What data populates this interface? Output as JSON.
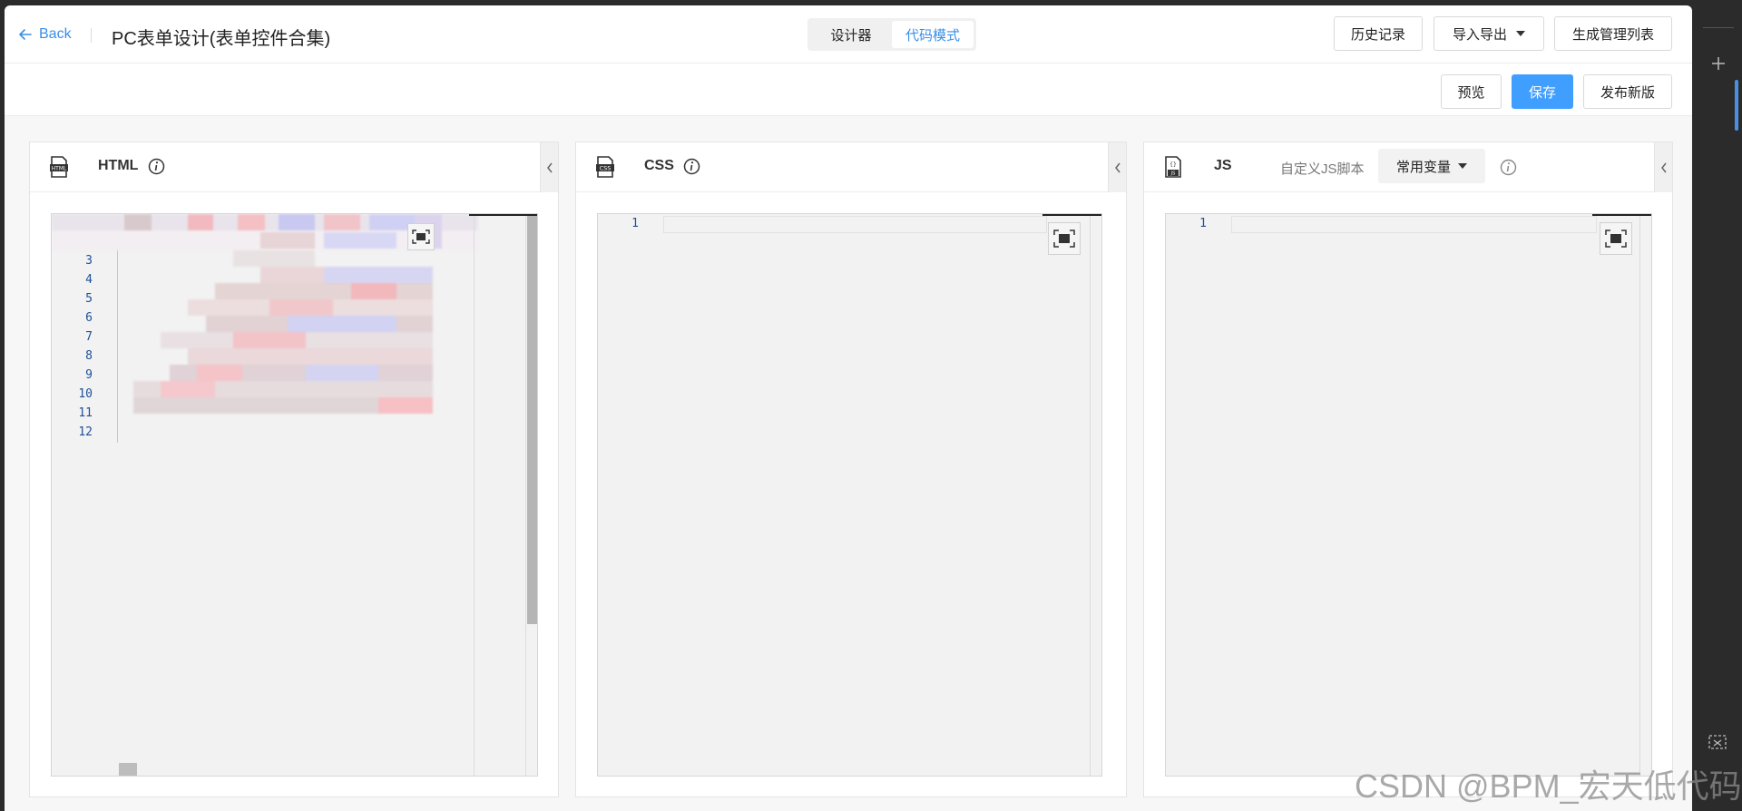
{
  "header": {
    "back_label": "Back",
    "page_title": "PC表单设计(表单控件合集)",
    "modes": [
      "设计器",
      "代码模式"
    ],
    "active_mode": "代码模式",
    "history_btn": "历史记录",
    "import_export_btn": "导入导出",
    "gen_list_btn": "生成管理列表"
  },
  "toolbar": {
    "preview": "预览",
    "save": "保存",
    "publish": "发布新版"
  },
  "panels": {
    "html": {
      "label": "HTML",
      "line_numbers": [
        "3",
        "4",
        "5",
        "6",
        "7",
        "8",
        "9",
        "10",
        "11",
        "12"
      ]
    },
    "css": {
      "label": "CSS",
      "line_numbers": [
        "1"
      ]
    },
    "js": {
      "label": "JS",
      "custom_label": "自定义JS脚本",
      "variable_select": "常用变量",
      "line_numbers": [
        "1"
      ]
    }
  },
  "icons": {
    "back": "arrow-left-icon",
    "info": "info-circle-icon",
    "collapse": "chevron-left-icon",
    "fullscreen": "fullscreen-icon",
    "html_file": "html-file-icon",
    "css_file": "css-file-icon",
    "js_file": "js-file-icon"
  },
  "colors": {
    "accent": "#409eff",
    "link": "#3a8ee6"
  },
  "watermark": "CSDN @BPM_宏天低代码"
}
